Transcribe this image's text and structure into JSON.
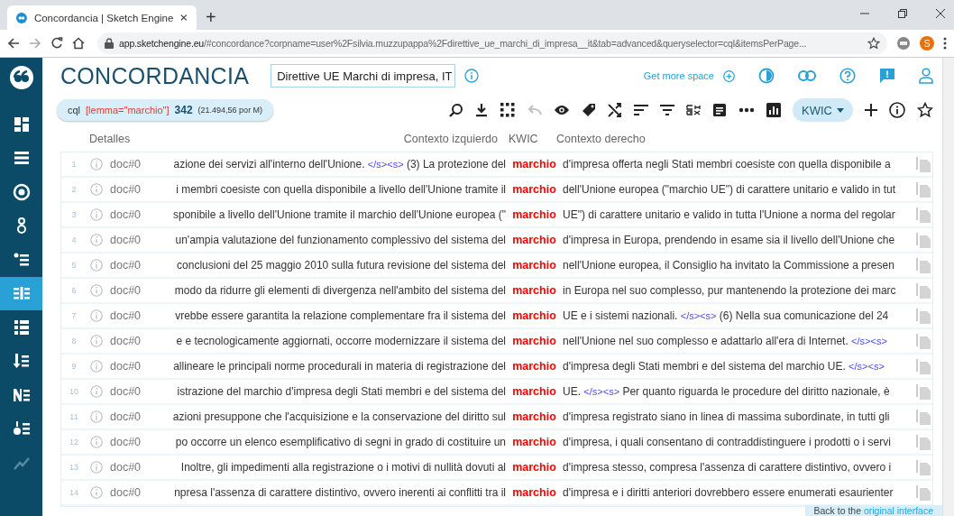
{
  "browser": {
    "tab_title": "Concordancia | Sketch Engine",
    "new_tab": "+",
    "url_host": "app.sketchengine.eu",
    "url_path": "/#concordance?corpname=user%2Fsilvia.muzzupappa%2Fdirettive_ue_marchi_di_impresa__it&tab=advanced&queryselector=cql&itemsPerPage...",
    "profile_initial": "S"
  },
  "sidebar": {
    "items": [
      {
        "kind": "dashboard",
        "selected": false
      },
      {
        "kind": "list",
        "selected": false
      },
      {
        "kind": "target",
        "selected": false
      },
      {
        "kind": "rings",
        "selected": false
      },
      {
        "kind": "bullets",
        "selected": false
      },
      {
        "kind": "concordance",
        "selected": true
      },
      {
        "kind": "grid",
        "selected": false
      },
      {
        "kind": "sort",
        "selected": false
      },
      {
        "kind": "ngrams",
        "selected": false
      },
      {
        "kind": "keywords",
        "selected": false
      },
      {
        "kind": "trends",
        "selected": false,
        "disabled": true
      }
    ]
  },
  "header": {
    "title": "CONCORDANCIA",
    "corpus": "Direttive UE Marchi di impresa, IT",
    "get_more_space": "Get more space"
  },
  "query": {
    "type": "cql",
    "expression": "[lemma=\"marchio\"]",
    "hits": "342",
    "per_million": "(21.494,56 por M)"
  },
  "toolbar": {
    "tools": [
      {
        "kind": "search"
      },
      {
        "kind": "download"
      },
      {
        "kind": "dots-grid"
      },
      {
        "kind": "undo"
      },
      {
        "kind": "eye"
      },
      {
        "kind": "tag"
      },
      {
        "kind": "shuffle"
      },
      {
        "kind": "sort"
      },
      {
        "kind": "filter"
      },
      {
        "kind": "gdex"
      },
      {
        "kind": "note"
      },
      {
        "kind": "ellipsis"
      },
      {
        "kind": "chart"
      }
    ],
    "view_button": "KWIC"
  },
  "table": {
    "columns": [
      "Detalles",
      "Contexto izquierdo",
      "KWIC",
      "Contexto derecho"
    ],
    "rows": [
      {
        "number": "1",
        "doc": "doc#0",
        "left": [
          {
            "kind": "text",
            "text": "azione dei servizi all'interno dell'Unione. "
          },
          {
            "kind": "tag",
            "text": "</s><s>"
          },
          {
            "kind": "text",
            "text": " (3) La protezione del"
          }
        ],
        "kwic": "marchio",
        "right": [
          {
            "kind": "text",
            "text": "d'impresa offerta negli Stati membri coesiste con quella disponibile a"
          }
        ]
      },
      {
        "number": "2",
        "doc": "doc#0",
        "left": [
          {
            "kind": "text",
            "text": "i membri coesiste con quella disponibile a livello dell'Unione tramite il"
          }
        ],
        "kwic": "marchio",
        "right": [
          {
            "kind": "text",
            "text": "dell'Unione europea (\"marchio UE\") di carattere unitario e valido in tut"
          }
        ]
      },
      {
        "number": "3",
        "doc": "doc#0",
        "left": [
          {
            "kind": "text",
            "text": "sponibile a livello dell'Unione tramite il marchio dell'Unione europea (\""
          }
        ],
        "kwic": "marchio",
        "right": [
          {
            "kind": "text",
            "text": "UE\") di carattere unitario e valido in tutta l'Unione a norma del regolar"
          }
        ]
      },
      {
        "number": "4",
        "doc": "doc#0",
        "left": [
          {
            "kind": "text",
            "text": "un'ampia valutazione del funzionamento complessivo del sistema del"
          }
        ],
        "kwic": "marchio",
        "right": [
          {
            "kind": "text",
            "text": "d'impresa in Europa, prendendo in esame sia il livello dell'Unione che"
          }
        ]
      },
      {
        "number": "5",
        "doc": "doc#0",
        "left": [
          {
            "kind": "text",
            "text": "conclusioni del 25 maggio 2010 sulla futura revisione del sistema del"
          }
        ],
        "kwic": "marchio",
        "right": [
          {
            "kind": "text",
            "text": "nell'Unione europea, il Consiglio ha invitato la Commissione a presen"
          }
        ]
      },
      {
        "number": "6",
        "doc": "doc#0",
        "left": [
          {
            "kind": "text",
            "text": "modo da ridurre gli elementi di divergenza nell'ambito del sistema del"
          }
        ],
        "kwic": "marchio",
        "right": [
          {
            "kind": "text",
            "text": "in Europa nel suo complesso, pur mantenendo la protezione dei marc"
          }
        ]
      },
      {
        "number": "7",
        "doc": "doc#0",
        "left": [
          {
            "kind": "text",
            "text": "vrebbe essere garantita la relazione complementare fra il sistema del"
          }
        ],
        "kwic": "marchio",
        "right": [
          {
            "kind": "text",
            "text": "UE e i sistemi nazionali. "
          },
          {
            "kind": "tag",
            "text": "</s><s>"
          },
          {
            "kind": "text",
            "text": " (6) Nella sua comunicazione del 24"
          }
        ]
      },
      {
        "number": "8",
        "doc": "doc#0",
        "left": [
          {
            "kind": "text",
            "text": "e e tecnologicamente aggiornati, occorre modernizzare il sistema del"
          }
        ],
        "kwic": "marchio",
        "right": [
          {
            "kind": "text",
            "text": "nell'Unione nel suo complesso e adattarlo all'era di Internet. "
          },
          {
            "kind": "tag",
            "text": "</s><s>"
          }
        ]
      },
      {
        "number": "9",
        "doc": "doc#0",
        "left": [
          {
            "kind": "text",
            "text": "allineare le principali norme procedurali in materia di registrazione del"
          }
        ],
        "kwic": "marchio",
        "right": [
          {
            "kind": "text",
            "text": "d'impresa degli Stati membri e del sistema del marchio UE. "
          },
          {
            "kind": "tag",
            "text": "</s><s>"
          }
        ]
      },
      {
        "number": "10",
        "doc": "doc#0",
        "left": [
          {
            "kind": "text",
            "text": "istrazione del marchio d'impresa degli Stati membri e del sistema del"
          }
        ],
        "kwic": "marchio",
        "right": [
          {
            "kind": "text",
            "text": "UE. "
          },
          {
            "kind": "tag",
            "text": "</s><s>"
          },
          {
            "kind": "text",
            "text": " Per quanto riguarda le procedure del diritto nazionale, è"
          }
        ]
      },
      {
        "number": "11",
        "doc": "doc#0",
        "left": [
          {
            "kind": "text",
            "text": "azioni presuppone che l'acquisizione e la conservazione del diritto sul"
          }
        ],
        "kwic": "marchio",
        "right": [
          {
            "kind": "text",
            "text": "d'impresa registrato siano in linea di massima subordinate, in tutti gli"
          }
        ]
      },
      {
        "number": "12",
        "doc": "doc#0",
        "left": [
          {
            "kind": "text",
            "text": "po occorre un elenco esemplificativo di segni in grado di costituire un"
          }
        ],
        "kwic": "marchio",
        "right": [
          {
            "kind": "text",
            "text": "d'impresa, i quali consentano di contraddistinguere i prodotti o i servi"
          }
        ]
      },
      {
        "number": "13",
        "doc": "doc#0",
        "left": [
          {
            "kind": "text",
            "text": "Inoltre, gli impedimenti alla registrazione o i motivi di nullità dovuti al"
          }
        ],
        "kwic": "marchio",
        "right": [
          {
            "kind": "text",
            "text": "d'impresa stesso, compresa l'assenza di carattere distintivo, ovvero i"
          }
        ]
      },
      {
        "number": "14",
        "doc": "doc#0",
        "left": [
          {
            "kind": "text",
            "text": "npresa l'assenza di carattere distintivo, ovvero inerenti ai conflitti tra il"
          }
        ],
        "kwic": "marchio",
        "right": [
          {
            "kind": "text",
            "text": "d'impresa e i diritti anteriori dovrebbero essere enumerati esaurienter"
          }
        ]
      }
    ]
  },
  "footer_note": {
    "text": "Back to the ",
    "link": "original interface"
  }
}
